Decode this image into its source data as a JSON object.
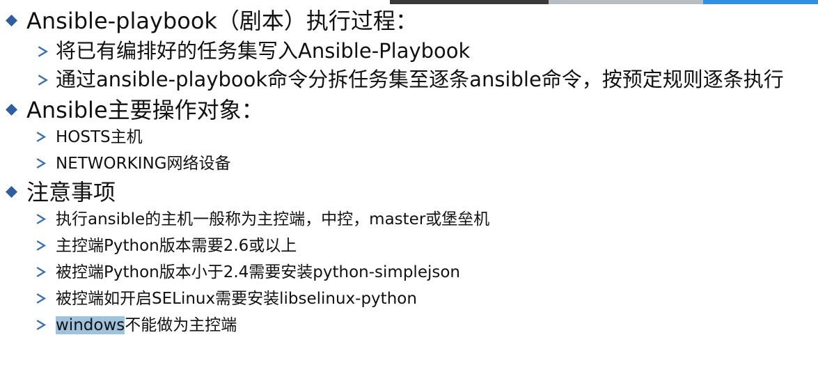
{
  "colors": {
    "bullet": "#2f5d9e",
    "arrow": "#3a6fb0",
    "highlight": "#9fc3dd"
  },
  "sections": [
    {
      "heading": "Ansible-playbook（剧本）执行过程：",
      "items": [
        "将已有编排好的任务集写入Ansible-Playbook",
        "通过ansible-playbook命令分拆任务集至逐条ansible命令，按预定规则逐条执行"
      ]
    },
    {
      "heading": "Ansible主要操作对象：",
      "items": [
        "HOSTS主机",
        "NETWORKING网络设备"
      ]
    },
    {
      "heading": "注意事项",
      "items": [
        "执行ansible的主机一般称为主控端，中控，master或堡垒机",
        "主控端Python版本需要2.6或以上",
        "被控端Python版本小于2.4需要安装python-simplejson",
        "被控端如开启SELinux需要安装libselinux-python"
      ],
      "last_item": {
        "highlighted": "windows",
        "rest": "不能做为主控端"
      }
    }
  ]
}
